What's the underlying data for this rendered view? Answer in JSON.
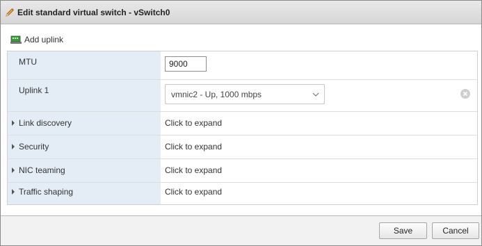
{
  "dialog": {
    "title": "Edit standard virtual switch - vSwitch0",
    "title_icon": "pencil-icon"
  },
  "toolbar": {
    "add_uplink_label": "Add uplink",
    "add_uplink_icon": "network-adapter-icon"
  },
  "settings": {
    "mtu": {
      "label": "MTU",
      "value": "9000"
    },
    "uplink1": {
      "label": "Uplink 1",
      "selected": "vmnic2 - Up, 1000 mbps"
    },
    "sections": [
      {
        "label": "Link discovery",
        "value": "Click to expand"
      },
      {
        "label": "Security",
        "value": "Click to expand"
      },
      {
        "label": "NIC teaming",
        "value": "Click to expand"
      },
      {
        "label": "Traffic shaping",
        "value": "Click to expand"
      }
    ]
  },
  "footer": {
    "save_label": "Save",
    "cancel_label": "Cancel"
  },
  "colors": {
    "label_column_bg": "#e4edf5",
    "titlebar_bg": "#dedede",
    "footer_bg": "#f2f2f2"
  }
}
